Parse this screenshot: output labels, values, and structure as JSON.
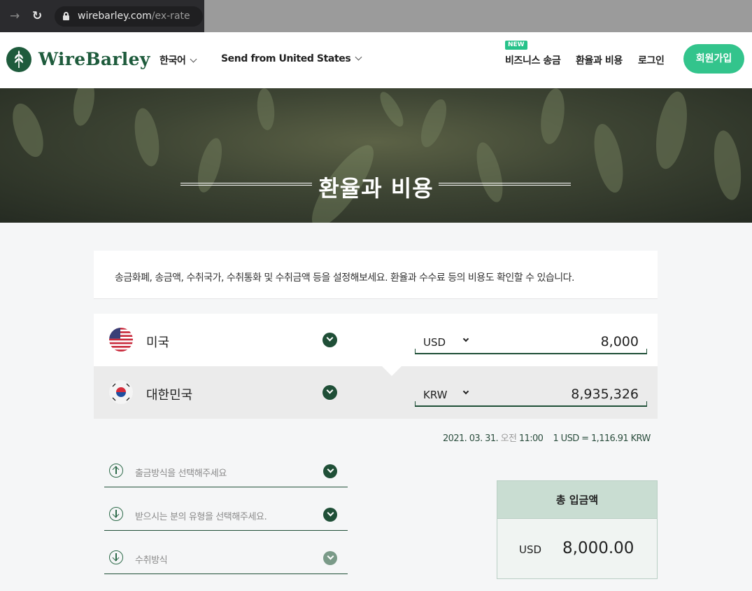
{
  "browser": {
    "url_domain": "wirebarley.com",
    "url_path": "/ex-rate"
  },
  "header": {
    "logo_text": "WireBarley",
    "language": "한국어",
    "send_from": "Send from United States",
    "new_badge": "NEW",
    "business": "비즈니스 송금",
    "rates": "환율과 비용",
    "login": "로그인",
    "join": "회원가입"
  },
  "hero": {
    "title": "환율과 비용"
  },
  "calculator": {
    "description": "송금화폐, 송금액, 수취국가, 수취통화 및 수취금액 등을 설정해보세요. 환율과 수수료 등의 비용도 확인할 수 있습니다.",
    "from": {
      "country": "미국",
      "currency": "USD",
      "amount": "8,000"
    },
    "to": {
      "country": "대한민국",
      "currency": "KRW",
      "amount": "8,935,326"
    },
    "rate_date": "2021. 03. 31.",
    "rate_ampm": "오전",
    "rate_time": "11:00",
    "rate_text": "1 USD = 1,116.91 KRW"
  },
  "options": {
    "payout_method": "출금방식을 선택해주세요",
    "recipient_type": "받으시는 분의 유형을 선택해주세요.",
    "receive_method": "수취방식"
  },
  "total": {
    "label": "총 입금액",
    "currency": "USD",
    "amount": "8,000.00"
  },
  "colors": {
    "brand_green": "#1e5b3c",
    "accent_green": "#33c48c",
    "new_badge": "#27c28a"
  },
  "icons": [
    "back-arrow-icon",
    "reload-icon",
    "lock-icon",
    "wheat-logo-icon",
    "chevron-down-icon",
    "us-flag-icon",
    "kr-flag-icon",
    "arrow-up-circle-icon",
    "arrow-down-circle-icon"
  ]
}
